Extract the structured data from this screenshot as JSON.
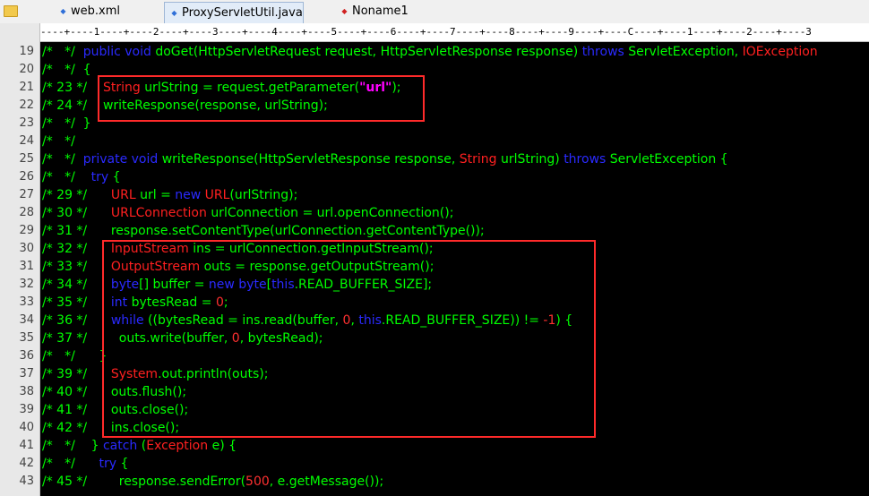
{
  "tabs": [
    {
      "label": "web.xml",
      "icon": "diamond-icon",
      "icon_color": "#2f6fd8",
      "active": false
    },
    {
      "label": "ProxyServletUtil.java",
      "icon": "diamond-icon",
      "icon_color": "#2f6fd8",
      "active": true
    },
    {
      "label": "Noname1",
      "icon": "diamond-icon",
      "icon_color": "#d02020",
      "active": false
    }
  ],
  "ruler": "----+----1----+----2----+----3----+----4----+----5----+----6----+----7----+----8----+----9----+----C----+----1----+----2----+----3",
  "colors": {
    "background": "#000000",
    "comment": "#00ff00",
    "keyword": "#2a2aff",
    "type": "#ff2020",
    "highlight_box": "#ff2a2a"
  },
  "lines": [
    {
      "n": "19",
      "t": [
        [
          "/*   */  ",
          "com"
        ],
        [
          "public void ",
          "kw"
        ],
        [
          "doGet(HttpServletRequest request, HttpServletResponse response) ",
          "plain"
        ],
        [
          "throws ",
          "kw"
        ],
        [
          "ServletException, ",
          "plain"
        ],
        [
          "IOException",
          "type"
        ]
      ]
    },
    {
      "n": "20",
      "t": [
        [
          "/*   */  {",
          "com"
        ]
      ]
    },
    {
      "n": "21",
      "t": [
        [
          "/* 23 */    ",
          "com"
        ],
        [
          "String ",
          "type"
        ],
        [
          "urlString = request.getParameter(",
          "plain"
        ],
        [
          "\"url\"",
          "str"
        ],
        [
          ");",
          "plain"
        ]
      ]
    },
    {
      "n": "22",
      "t": [
        [
          "/* 24 */    ",
          "com"
        ],
        [
          "writeResponse(response, urlString);",
          "plain"
        ]
      ]
    },
    {
      "n": "23",
      "t": [
        [
          "/*   */  }",
          "com"
        ]
      ]
    },
    {
      "n": "24",
      "t": [
        [
          "/*   */",
          "com"
        ]
      ]
    },
    {
      "n": "25",
      "t": [
        [
          "/*   */  ",
          "com"
        ],
        [
          "private void ",
          "kw"
        ],
        [
          "writeResponse(HttpServletResponse response, ",
          "plain"
        ],
        [
          "String ",
          "type"
        ],
        [
          "urlString) ",
          "plain"
        ],
        [
          "throws ",
          "kw"
        ],
        [
          "ServletException {",
          "plain"
        ]
      ]
    },
    {
      "n": "26",
      "t": [
        [
          "/*   */    ",
          "com"
        ],
        [
          "try ",
          "kw"
        ],
        [
          "{",
          "plain"
        ]
      ]
    },
    {
      "n": "27",
      "t": [
        [
          "/* 29 */      ",
          "com"
        ],
        [
          "URL ",
          "type"
        ],
        [
          "url = ",
          "plain"
        ],
        [
          "new ",
          "kw"
        ],
        [
          "URL",
          "type"
        ],
        [
          "(urlString);",
          "plain"
        ]
      ]
    },
    {
      "n": "28",
      "t": [
        [
          "/* 30 */      ",
          "com"
        ],
        [
          "URLConnection ",
          "type"
        ],
        [
          "urlConnection = url.openConnection();",
          "plain"
        ]
      ]
    },
    {
      "n": "29",
      "t": [
        [
          "/* 31 */      ",
          "com"
        ],
        [
          "response.setContentType(urlConnection.getContentType());",
          "plain"
        ]
      ]
    },
    {
      "n": "30",
      "t": [
        [
          "/* 32 */      ",
          "com"
        ],
        [
          "InputStream ",
          "type"
        ],
        [
          "ins = urlConnection.getInputStream();",
          "plain"
        ]
      ]
    },
    {
      "n": "31",
      "t": [
        [
          "/* 33 */      ",
          "com"
        ],
        [
          "OutputStream ",
          "type"
        ],
        [
          "outs = response.getOutputStream();",
          "plain"
        ]
      ]
    },
    {
      "n": "32",
      "t": [
        [
          "/* 34 */      ",
          "com"
        ],
        [
          "byte",
          "kw"
        ],
        [
          "[] buffer = ",
          "plain"
        ],
        [
          "new byte",
          "kw"
        ],
        [
          "[",
          "plain"
        ],
        [
          "this",
          "kw"
        ],
        [
          ".READ_BUFFER_SIZE];",
          "plain"
        ]
      ]
    },
    {
      "n": "33",
      "t": [
        [
          "/* 35 */      ",
          "com"
        ],
        [
          "int ",
          "kw"
        ],
        [
          "bytesRead = ",
          "plain"
        ],
        [
          "0",
          "num"
        ],
        [
          ";",
          "plain"
        ]
      ]
    },
    {
      "n": "34",
      "t": [
        [
          "/* 36 */      ",
          "com"
        ],
        [
          "while ",
          "kw"
        ],
        [
          "((bytesRead = ins.read(buffer, ",
          "plain"
        ],
        [
          "0",
          "num"
        ],
        [
          ", ",
          "plain"
        ],
        [
          "this",
          "kw"
        ],
        [
          ".READ_BUFFER_SIZE)) != ",
          "plain"
        ],
        [
          "-1",
          "num"
        ],
        [
          ") {",
          "plain"
        ]
      ]
    },
    {
      "n": "35",
      "t": [
        [
          "/* 37 */        ",
          "com"
        ],
        [
          "outs.write(buffer, ",
          "plain"
        ],
        [
          "0",
          "num"
        ],
        [
          ", bytesRead);",
          "plain"
        ]
      ]
    },
    {
      "n": "36",
      "t": [
        [
          "/*   */      }",
          "com"
        ]
      ]
    },
    {
      "n": "37",
      "t": [
        [
          "/* 39 */      ",
          "com"
        ],
        [
          "System",
          "type"
        ],
        [
          ".out.println(outs);",
          "plain"
        ]
      ]
    },
    {
      "n": "38",
      "t": [
        [
          "/* 40 */      ",
          "com"
        ],
        [
          "outs.flush();",
          "plain"
        ]
      ]
    },
    {
      "n": "39",
      "t": [
        [
          "/* 41 */      ",
          "com"
        ],
        [
          "outs.close();",
          "plain"
        ]
      ]
    },
    {
      "n": "40",
      "t": [
        [
          "/* 42 */      ",
          "com"
        ],
        [
          "ins.close();",
          "plain"
        ]
      ]
    },
    {
      "n": "41",
      "t": [
        [
          "/*   */    } ",
          "com"
        ],
        [
          "catch ",
          "kw"
        ],
        [
          "(",
          "plain"
        ],
        [
          "Exception ",
          "type"
        ],
        [
          "e) {",
          "plain"
        ]
      ]
    },
    {
      "n": "42",
      "t": [
        [
          "/*   */      ",
          "com"
        ],
        [
          "try ",
          "kw"
        ],
        [
          "{",
          "plain"
        ]
      ]
    },
    {
      "n": "43",
      "t": [
        [
          "/* 45 */        ",
          "com"
        ],
        [
          "response.sendError(",
          "plain"
        ],
        [
          "500",
          "num"
        ],
        [
          ", e.getMessage());",
          "plain"
        ]
      ]
    }
  ]
}
